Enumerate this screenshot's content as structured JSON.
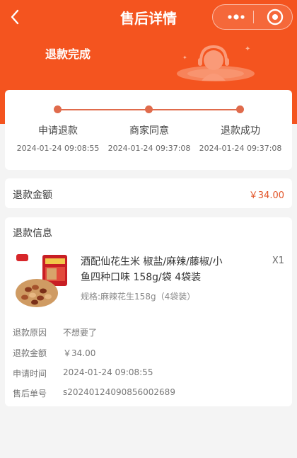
{
  "nav": {
    "title": "售后详情",
    "back_icon": "chevron-left-icon",
    "more_icon": "more-dots-icon",
    "target_icon": "target-icon"
  },
  "status": {
    "text": "退款完成",
    "illustration_icon": "customer-service-headset-icon"
  },
  "colors": {
    "brand": "#f4541f",
    "progress": "#e06b4c",
    "price": "#e2562a"
  },
  "steps": [
    {
      "label": "申请退款",
      "time": "2024-01-24 09:08:55"
    },
    {
      "label": "商家同意",
      "time": "2024-01-24 09:37:08"
    },
    {
      "label": "退款成功",
      "time": "2024-01-24 09:37:08"
    }
  ],
  "refund_amount": {
    "label": "退款金额",
    "value": "￥34.00"
  },
  "refund_info": {
    "title": "退款信息",
    "product": {
      "name": "酒配仙花生米 椒盐/麻辣/藤椒/小鱼四种口味 158g/袋 4袋装",
      "quantity": "X1",
      "spec": "规格:麻辣花生158g（4袋装）",
      "image_icon": "peanut-snack-bag-icon"
    },
    "rows": [
      {
        "label": "退款原因",
        "value": "不想要了"
      },
      {
        "label": "退款金额",
        "value": "￥34.00"
      },
      {
        "label": "申请时间",
        "value": "2024-01-24 09:08:55"
      },
      {
        "label": "售后单号",
        "value": "s20240124090856002689"
      }
    ]
  }
}
